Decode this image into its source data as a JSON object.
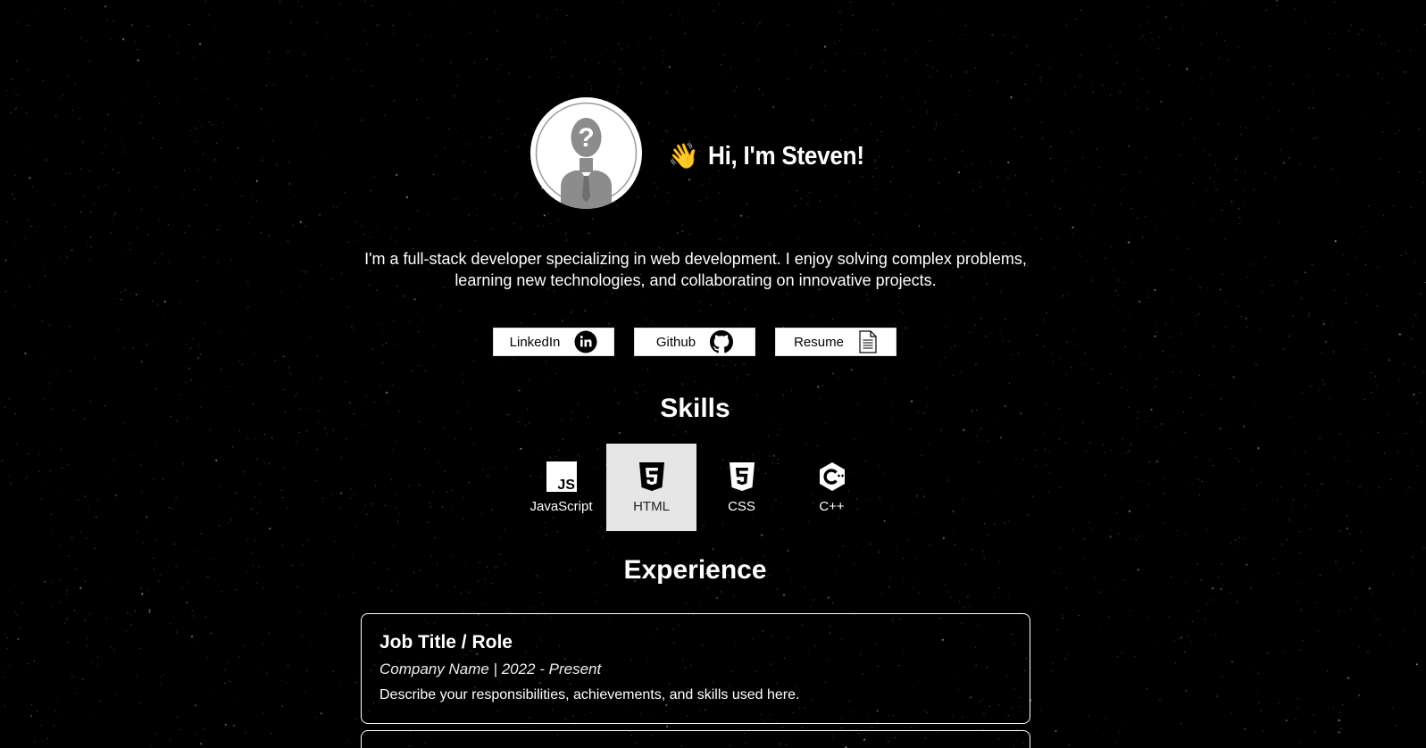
{
  "profile": {
    "greeting_emoji": "👋",
    "greeting": "Hi, I'm Steven!",
    "intro": "I'm a full-stack developer specializing in web development. I enjoy solving complex problems, learning new technologies, and collaborating on innovative projects."
  },
  "links": [
    {
      "label": "LinkedIn",
      "icon": "linkedin-icon"
    },
    {
      "label": "Github",
      "icon": "github-icon"
    },
    {
      "label": "Resume",
      "icon": "document-icon"
    }
  ],
  "skills": {
    "title": "Skills",
    "items": [
      {
        "label": "JavaScript",
        "icon": "javascript-icon",
        "active": false
      },
      {
        "label": "HTML",
        "icon": "html5-icon",
        "active": true
      },
      {
        "label": "CSS",
        "icon": "css3-icon",
        "active": false
      },
      {
        "label": "C++",
        "icon": "cplusplus-icon",
        "active": false
      }
    ]
  },
  "experience": {
    "title": "Experience",
    "jobs": [
      {
        "title": "Job Title / Role",
        "meta": "Company Name | 2022 - Present",
        "description": "Describe your responsibilities, achievements, and skills used here."
      }
    ]
  },
  "colors": {
    "background": "#000000",
    "text": "#ffffff",
    "button_bg": "#ffffff",
    "active_skill_bg": "#e6e6e6"
  }
}
